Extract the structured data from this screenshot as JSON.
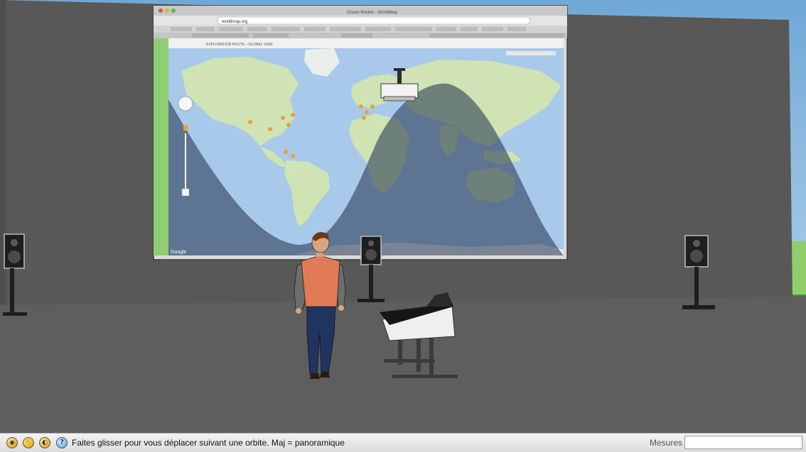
{
  "browser": {
    "window_title": "Ocean Rocker - WorldMap",
    "url": "worldmap.org",
    "map_heading": "EXPLORATION ROUTE – GLOBAL VIEW",
    "map_attribution": "Google"
  },
  "statusbar": {
    "hint_text": "Faites glisser pour vous déplacer suivant une orbite.  Maj = panoramique",
    "measures_label": "Mesures",
    "measures_value": "",
    "tool_icons": [
      "orbit-icon",
      "pan-icon",
      "zoom-icon"
    ],
    "help_glyph": "?"
  },
  "colors": {
    "sky": "#9cc3e3",
    "grass": "#8fce6a",
    "wall": "#585858",
    "floor": "#5f5f5f",
    "ocean": "#a9c9ea",
    "land": "#cfe3b4",
    "night_shade": "#1f2f4a",
    "statusbar": "#e6e6e6"
  }
}
